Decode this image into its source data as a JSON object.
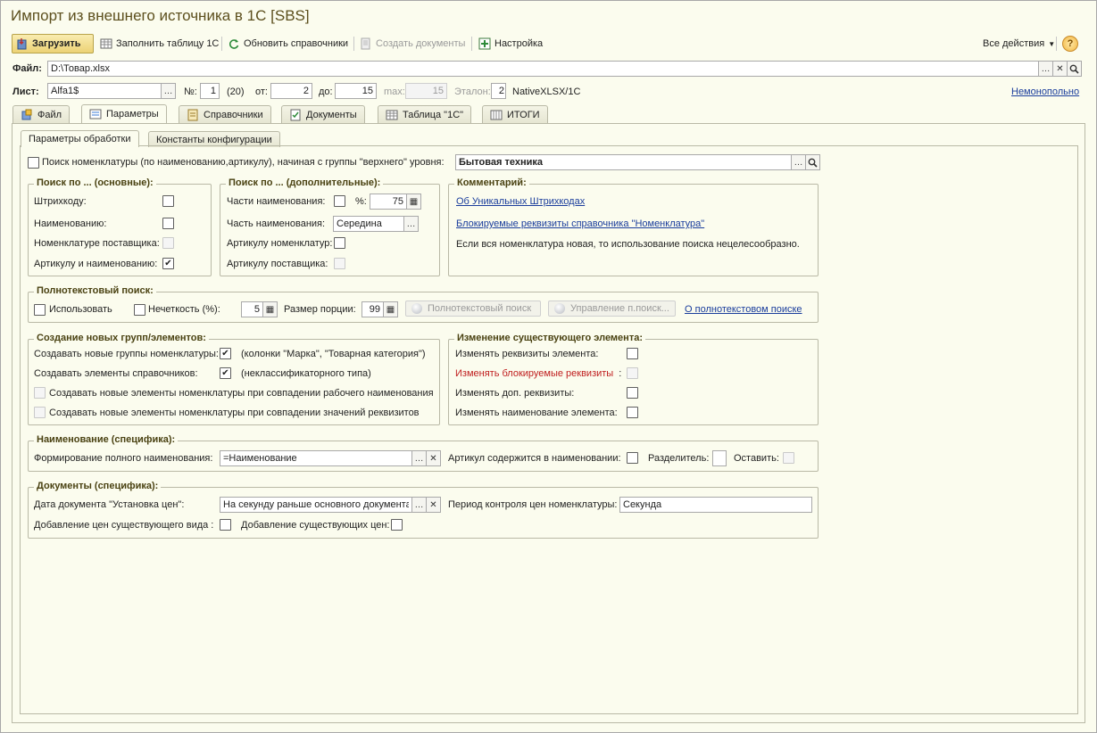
{
  "window": {
    "title": "Импорт из внешнего источника в 1С [SBS]"
  },
  "toolbar": {
    "load": "Загрузить",
    "fill_table": "Заполнить таблицу 1С",
    "update_refs": "Обновить справочники",
    "create_docs": "Создать документы",
    "settings": "Настройка",
    "all_actions": "Все действия",
    "help": "?"
  },
  "file": {
    "label": "Файл:",
    "value": "D:\\Товар.xlsx"
  },
  "sheet": {
    "label": "Лист:",
    "value": "Alfa1$",
    "no_label": "№:",
    "no_value": "1",
    "count": "(20)",
    "from_label": "от:",
    "from_value": "2",
    "to_label": "до:",
    "to_value": "15",
    "max_label": "max:",
    "max_value": "15",
    "etalon_label": "Эталон:",
    "etalon_value": "2",
    "engine": "NativeXLSX/1C",
    "link": "Немонопольно"
  },
  "tabs": [
    "Файл",
    "Параметры",
    "Справочники",
    "Документы",
    "Таблица \"1С\"",
    "ИТОГИ"
  ],
  "subtabs": [
    "Параметры обработки",
    "Константы конфигурации"
  ],
  "search_top": {
    "label": "Поиск номенклатуры (по наименованию,артикулу), начиная с группы \"верхнего\" уровня:",
    "value": "Бытовая техника"
  },
  "search_main": {
    "title": "Поиск по ... (основные):",
    "items": [
      "Штрихкоду:",
      "Наименованию:",
      "Номенклатуре поставщика:",
      "Артикулу и наименованию:"
    ]
  },
  "search_extra": {
    "title": "Поиск по ... (дополнительные):",
    "part_name": "Части наименования:",
    "percent_label": "%:",
    "percent_value": "75",
    "part_of_name": "Часть наименования:",
    "part_of_name_value": "Середина",
    "article_nom": "Артикулу номенклатур:",
    "article_sup": "Артикулу поставщика:"
  },
  "comment": {
    "title": "Комментарий:",
    "link1": "Об Уникальных Штрихкодах",
    "link2": "Блокируемые реквизиты справочника \"Номенклатура\"",
    "text": "Если вся номенклатура новая, то использование поиска нецелесообразно."
  },
  "fulltext": {
    "title": "Полнотекстовый поиск:",
    "use": "Использовать",
    "fuzzy": "Нечеткость (%):",
    "fuzzy_value": "5",
    "portion": "Размер порции:",
    "portion_value": "99",
    "btn_search": "Полнотекстовый поиск",
    "btn_manage": "Управление п.поиск...",
    "link": "О полнотекстовом поиске"
  },
  "create_new": {
    "title": "Создание новых групп/элементов:",
    "groups": "Создавать новые группы номенклатуры:",
    "groups_note": "(колонки \"Марка\", \"Товарная категория\")",
    "elements": "Создавать элементы справочников:",
    "elements_note": "(неклассификаторного типа)",
    "by_name": "Создавать новые элементы номенклатуры при совпадении рабочего наименования",
    "by_props": "Создавать новые элементы номенклатуры при совпадении значений реквизитов"
  },
  "change_existing": {
    "title": "Изменение существующего элемента:",
    "props": "Изменять реквизиты элемента:",
    "blocked": "Изменять блокируемые реквизиты",
    "blocked_colon": ":",
    "extra": "Изменять доп. реквизиты:",
    "name": "Изменять наименование элемента:"
  },
  "naming": {
    "title": "Наименование (специфика):",
    "full_name": "Формирование полного наименования:",
    "full_name_value": "=Наименование",
    "article_in_name": "Артикул содержится в наименовании:",
    "separator": "Разделитель:",
    "keep": "Оставить:"
  },
  "documents": {
    "title": "Документы (специфика):",
    "date_label": "Дата  документа \"Установка цен\":",
    "date_value": "На секунду раньше основного документа",
    "period_label": "Период контроля цен номенклатуры:",
    "period_value": "Секунда",
    "add_existing_kind": "Добавление цен существующего вида :",
    "add_existing": "Добавление существующих цен:"
  }
}
